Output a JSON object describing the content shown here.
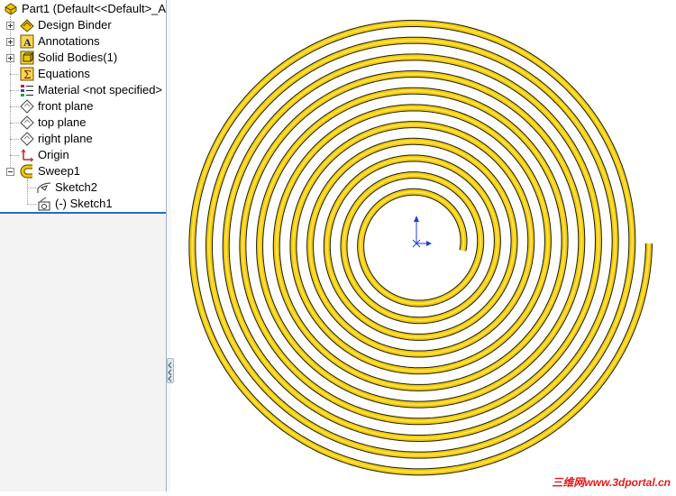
{
  "feature_tree": {
    "root_label": "Part1  (Default<<Default>_A",
    "items": [
      {
        "label": "Design Binder",
        "icon": "design-binder-icon",
        "expandable": true
      },
      {
        "label": "Annotations",
        "icon": "annotations-icon",
        "expandable": true
      },
      {
        "label": "Solid Bodies(1)",
        "icon": "solid-bodies-icon",
        "expandable": true
      },
      {
        "label": "Equations",
        "icon": "equations-icon",
        "expandable": false
      },
      {
        "label": "Material <not specified>",
        "icon": "material-icon",
        "expandable": false
      },
      {
        "label": "front plane",
        "icon": "plane-icon",
        "expandable": false
      },
      {
        "label": "top plane",
        "icon": "plane-icon",
        "expandable": false
      },
      {
        "label": "right plane",
        "icon": "plane-icon",
        "expandable": false
      },
      {
        "label": "Origin",
        "icon": "origin-icon",
        "expandable": false
      },
      {
        "label": "Sweep1",
        "icon": "sweep-icon",
        "expandable": true,
        "expanded": true
      },
      {
        "label": "Sketch2",
        "icon": "sketch-icon",
        "child": true
      },
      {
        "label": "(-) Sketch1",
        "icon": "sketch-icon",
        "child": true
      }
    ]
  },
  "viewport": {
    "model": "spiral-sweep",
    "spiral_color": "#f5cc00",
    "spiral_edge_color": "#1a1a1a",
    "triad_color": "#1f3fd0"
  },
  "watermark": "三维网www.3dportal.cn"
}
